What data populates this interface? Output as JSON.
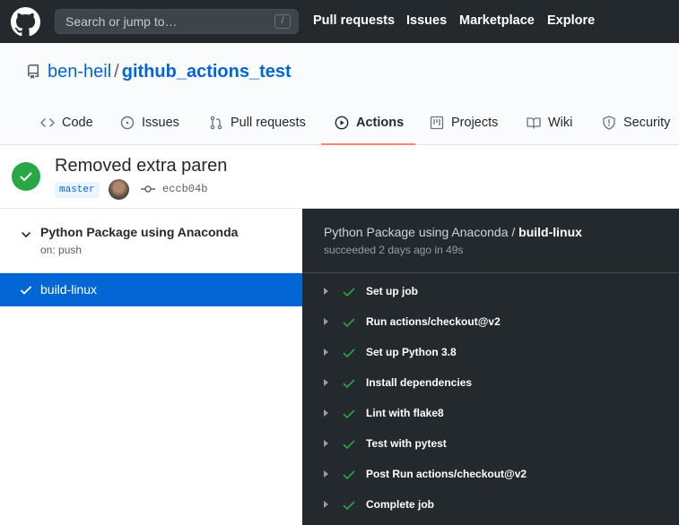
{
  "header": {
    "search_placeholder": "Search or jump to…",
    "search_shortcut": "/",
    "nav": [
      "Pull requests",
      "Issues",
      "Marketplace",
      "Explore"
    ]
  },
  "repo": {
    "owner": "ben-heil",
    "separator": "/",
    "name": "github_actions_test"
  },
  "tabs": [
    {
      "label": "Code",
      "icon": "code-icon"
    },
    {
      "label": "Issues",
      "icon": "issue-icon"
    },
    {
      "label": "Pull requests",
      "icon": "pull-request-icon"
    },
    {
      "label": "Actions",
      "icon": "play-icon",
      "active": true
    },
    {
      "label": "Projects",
      "icon": "project-icon"
    },
    {
      "label": "Wiki",
      "icon": "book-icon"
    },
    {
      "label": "Security",
      "icon": "shield-icon"
    }
  ],
  "run": {
    "title": "Removed extra paren",
    "branch": "master",
    "sha": "eccb04b",
    "status": "success"
  },
  "workflow": {
    "name": "Python Package using Anaconda",
    "trigger": "on: push",
    "jobs": [
      {
        "label": "build-linux",
        "selected": true
      }
    ]
  },
  "job_detail": {
    "workflow_prefix": "Python Package using Anaconda / ",
    "job_name": "build-linux",
    "status_text": "succeeded 2 days ago in 49s",
    "steps": [
      "Set up job",
      "Run actions/checkout@v2",
      "Set up Python 3.8",
      "Install dependencies",
      "Lint with flake8",
      "Test with pytest",
      "Post Run actions/checkout@v2",
      "Complete job"
    ]
  },
  "colors": {
    "header_bg": "#24292e",
    "link": "#0366d6",
    "success": "#28a745",
    "active_tab": "#f9826c",
    "dark_panel": "#24292e"
  }
}
